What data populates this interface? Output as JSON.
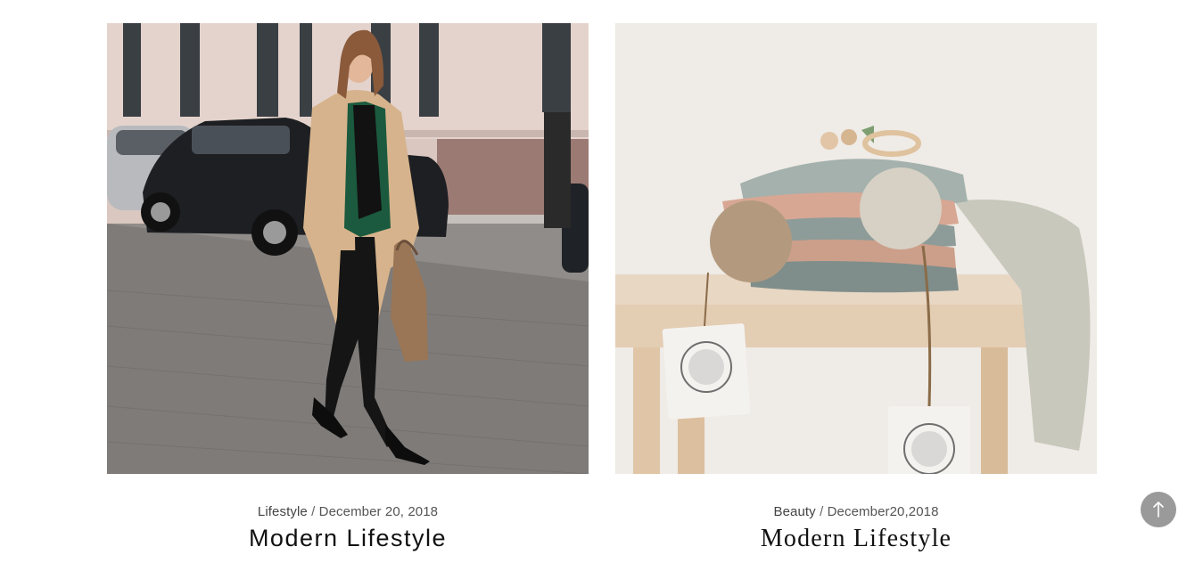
{
  "posts": [
    {
      "category": "Lifestyle",
      "separator": "/",
      "date": "December 20, 2018",
      "title": "Modern Lifestyle"
    },
    {
      "category": "Beauty",
      "separator": "/",
      "date": "December20,2018",
      "title": "Modern Lifestyle"
    }
  ],
  "colors": {
    "scroll_top_bg": "#9a9a9a",
    "title_text": "#111111",
    "meta_text": "#555555"
  },
  "icons": {
    "scroll_top": "arrow-up-icon"
  }
}
